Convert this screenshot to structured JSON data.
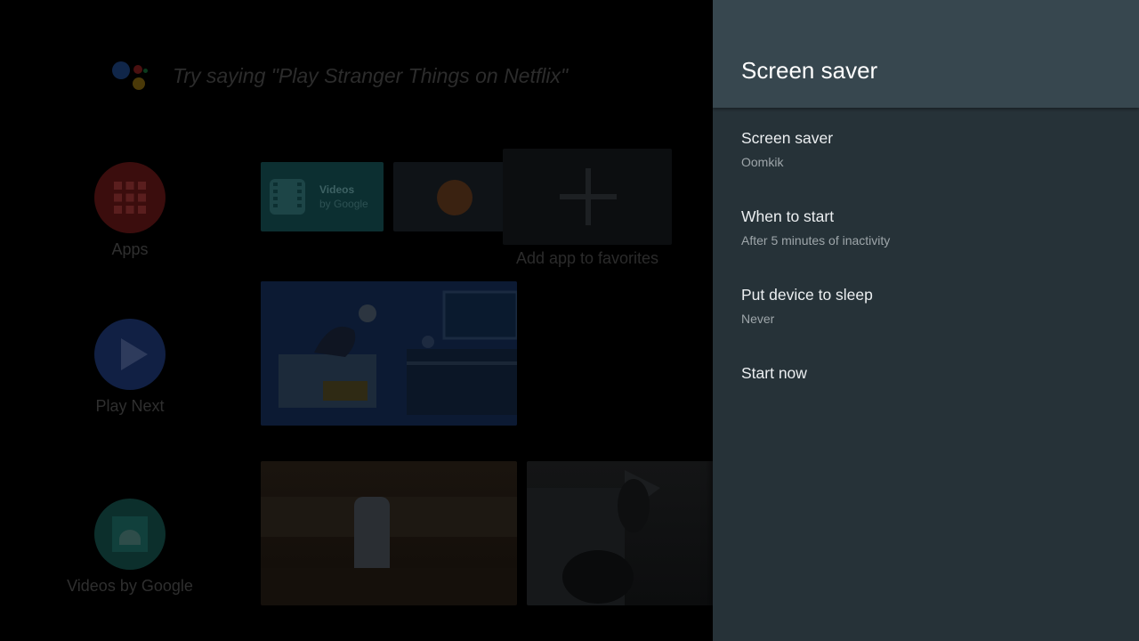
{
  "home": {
    "assistant_hint": "Try saying \"Play Stranger Things on Netflix\"",
    "nav": [
      {
        "label": "Apps",
        "color": "#3b0d0d"
      },
      {
        "label": "Play Next",
        "color": "#112044"
      },
      {
        "label": "Videos by Google",
        "color": "#0c2f2c"
      }
    ],
    "favorites": {
      "videos_tile_title": "Videos",
      "videos_tile_subtitle": "by Google",
      "add_label": "Add app to favorites"
    }
  },
  "panel": {
    "title": "Screen saver",
    "items": [
      {
        "title": "Screen saver",
        "subtitle": "Oomkik"
      },
      {
        "title": "When to start",
        "subtitle": "After 5 minutes of inactivity"
      },
      {
        "title": "Put device to sleep",
        "subtitle": "Never"
      },
      {
        "title": "Start now"
      }
    ]
  },
  "colors": {
    "panel_bg": "#263238",
    "panel_header_bg": "#37474f"
  }
}
